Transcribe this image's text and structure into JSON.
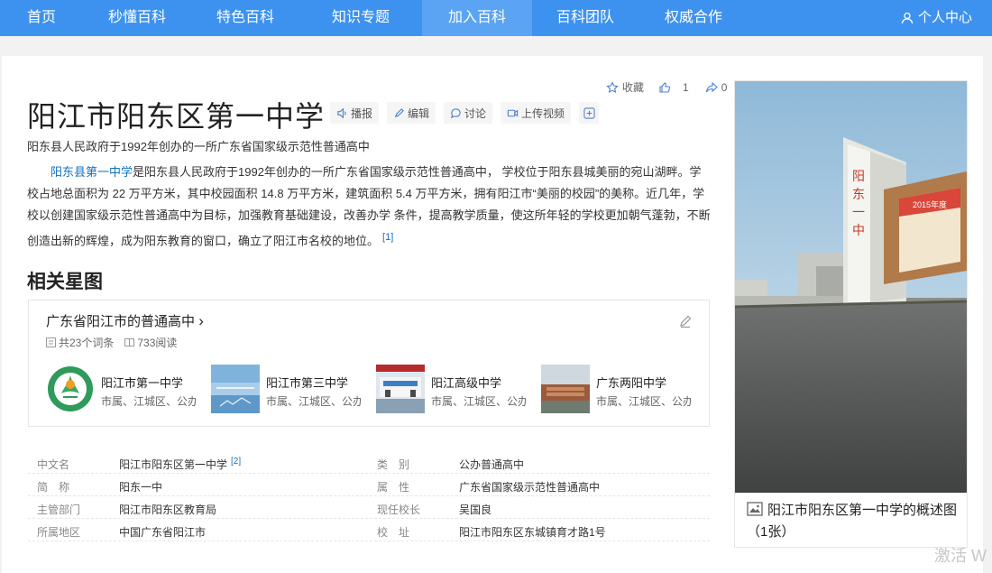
{
  "nav": {
    "items": [
      {
        "label": "首页"
      },
      {
        "label": "秒懂百科"
      },
      {
        "label": "特色百科"
      },
      {
        "label": "知识专题"
      },
      {
        "label": "加入百科"
      },
      {
        "label": "百科团队"
      },
      {
        "label": "权威合作"
      }
    ],
    "active": "加入百科",
    "user_label": "个人中心"
  },
  "entry": {
    "title": "阳江市阳东区第一中学",
    "tools": [
      "播报",
      "编辑",
      "讨论",
      "上传视频"
    ],
    "actions": {
      "favorite": "收藏",
      "likes": "1",
      "shares": "0"
    },
    "subtitle": "阳东县人民政府于1992年创办的一所广东省国家级示范性普通高中",
    "summary_link": "阳东县第一中学",
    "summary_text": "是阳东县人民政府于1992年创办的一所广东省国家级示范性普通高中， 学校位于阳东县城美丽的宛山湖畔。学校占地总面积为 22 万平方米，其中校园面积 14.8 万平方米，建筑面积 5.4 万平方米，拥有阳江市“美丽的校园”的美称。近几年，学校以创建国家级示范性普通高中为目标，加强教育基础建设，改善办学 条件，提高教学质量，使这所年轻的学校更加朝气蓬勃，不断创造出新的辉煌，成为阳东教育的窗口，确立了阳江市名校的地位。",
    "summary_ref": "[1]"
  },
  "star_map": {
    "section_title": "相关星图",
    "head": "广东省阳江市的普通高中",
    "chevron": "›",
    "entries_count": "共23个词条",
    "views": "733阅读",
    "cards": [
      {
        "name": "阳江市第一中学",
        "desc": "市属、江城区、公办"
      },
      {
        "name": "阳江市第三中学",
        "desc": "市属、江城区、公办"
      },
      {
        "name": "阳江高级中学",
        "desc": "市属、江城区、公办"
      },
      {
        "name": "广东两阳中学",
        "desc": "市属、江城区、公办"
      }
    ]
  },
  "info": {
    "rows": [
      {
        "k1": "中文名",
        "v1": "阳江市阳东区第一中学",
        "ref1": "[2]",
        "k2": "类　别",
        "v2": "公办普通高中"
      },
      {
        "k1": "简　称",
        "v1": "阳东一中",
        "ref1": "",
        "k2": "属　性",
        "v2": "广东省国家级示范性普通高中"
      },
      {
        "k1": "主管部门",
        "v1": "阳江市阳东区教育局",
        "ref1": "",
        "k2": "现任校长",
        "v2": "吴国良"
      },
      {
        "k1": "所属地区",
        "v1": "中国广东省阳江市",
        "ref1": "",
        "k2": "校　址",
        "v2": "阳江市阳东区东城镇育才路1号"
      }
    ]
  },
  "album": {
    "gate_text": "阳东一中",
    "banner_text": "2015年度",
    "caption": "阳江市阳东区第一中学的概述图（1张）"
  },
  "watermark": "激活 W",
  "colors": {
    "nav": "#3e92ef",
    "nav_active": "#5aa4f3",
    "link": "#136ec2"
  }
}
